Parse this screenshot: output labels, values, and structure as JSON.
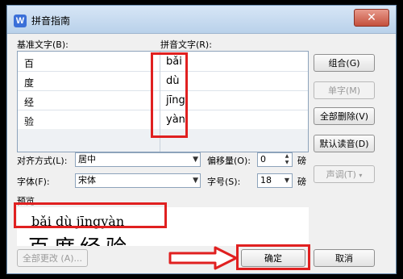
{
  "window": {
    "title": "拼音指南",
    "close_symbol": "✕",
    "app_icon_letter": "W"
  },
  "labels": {
    "base_text": "基准文字(B):",
    "ruby_text": "拼音文字(R):",
    "alignment": "对齐方式(L):",
    "offset": "偏移量(O):",
    "offset_unit": "磅",
    "font": "字体(F):",
    "size": "字号(S):",
    "size_unit": "磅",
    "preview": "预览"
  },
  "rows": [
    {
      "base": "百",
      "ruby": "bǎi"
    },
    {
      "base": "度",
      "ruby": "dù"
    },
    {
      "base": "经",
      "ruby": "jīng"
    },
    {
      "base": "验",
      "ruby": "yàn"
    }
  ],
  "controls": {
    "alignment_value": "居中",
    "offset_value": "0",
    "font_value": "宋体",
    "size_value": "18"
  },
  "buttons": {
    "group": "组合(G)",
    "single": "单字(M)",
    "delete_all": "全部删除(V)",
    "default_reading": "默认读音(D)",
    "tone": "声调(T)",
    "change_all": "全部更改 (A)...",
    "ok": "确定",
    "cancel": "取消"
  },
  "preview": {
    "pinyin": "bǎi dù jīngyàn",
    "hanzi": "百度经验"
  },
  "colors": {
    "highlight": "#e02020",
    "title_bar": "#c9dcf0"
  }
}
